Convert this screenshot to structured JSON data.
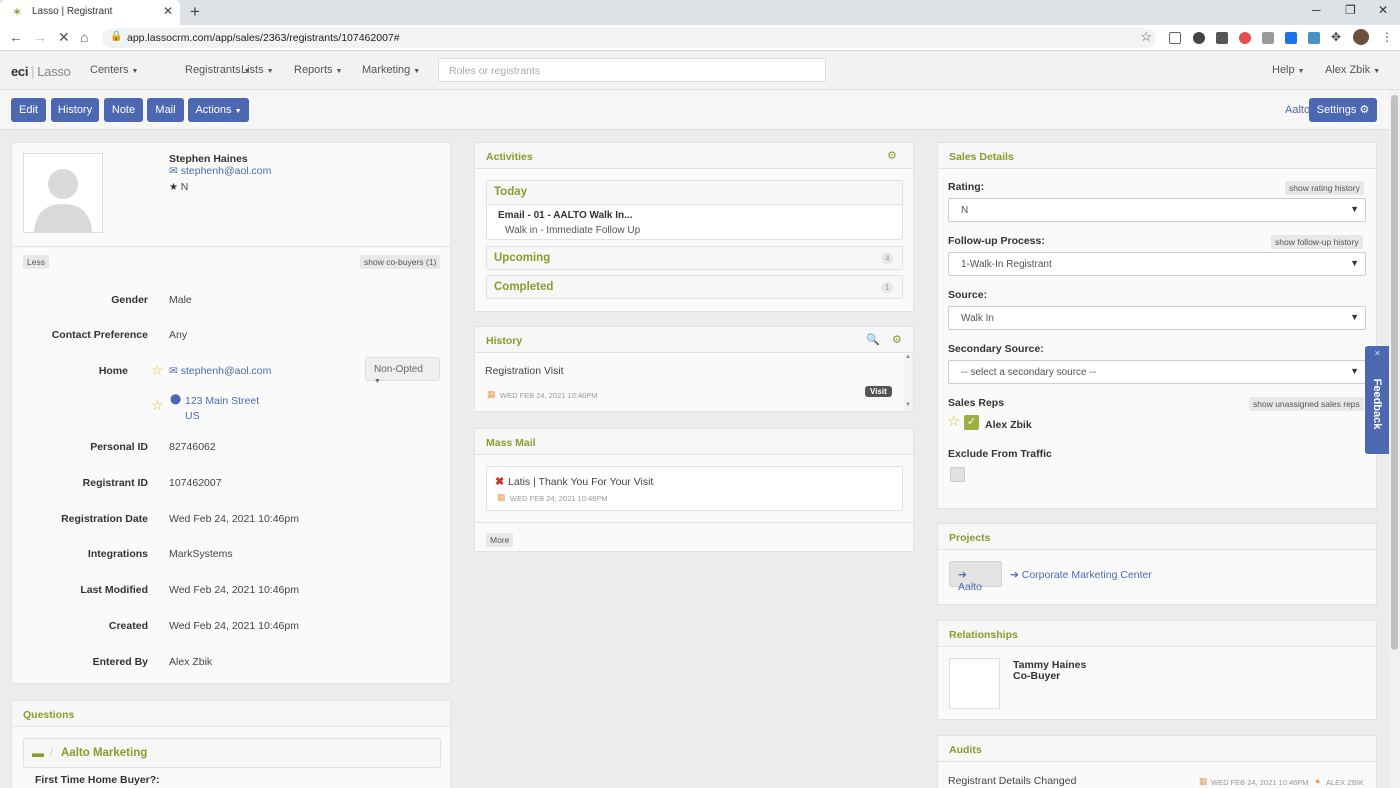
{
  "browser": {
    "tab_title": "Lasso | Registrant",
    "url": "app.lassocrm.com/app/sales/2363/registrants/107462007#"
  },
  "appnav": {
    "logo_main": "eci",
    "logo_sub": "Lasso",
    "menus": [
      "Centers",
      "Registrants",
      "Lists",
      "Reports",
      "Marketing"
    ],
    "search_placeholder": "Roles or registrants",
    "help": "Help",
    "user": "Alex Zbik"
  },
  "actionbar": {
    "buttons": [
      "Edit",
      "History",
      "Note",
      "Mail",
      "Actions"
    ],
    "project_link": "Aalto",
    "settings": "Settings"
  },
  "profile": {
    "name": "Stephen Haines",
    "email": "stephenh@aol.com",
    "rating": "N",
    "less": "Less",
    "show_cobuyers": "show co-buyers (1)",
    "fields": [
      {
        "label": "Gender",
        "value": "Male"
      },
      {
        "label": "Contact Preference",
        "value": "Any"
      },
      {
        "label": "Home",
        "value": "stephenh@aol.com"
      },
      {
        "label": "",
        "value": "123 Main Street"
      },
      {
        "label": "Personal ID",
        "value": "82746062"
      },
      {
        "label": "Registrant ID",
        "value": "107462007"
      },
      {
        "label": "Registration Date",
        "value": "Wed Feb 24, 2021 10:46pm"
      },
      {
        "label": "Integrations",
        "value": "MarkSystems"
      },
      {
        "label": "Last Modified",
        "value": "Wed Feb 24, 2021 10:46pm"
      },
      {
        "label": "Created",
        "value": "Wed Feb 24, 2021 10:46pm"
      },
      {
        "label": "Entered By",
        "value": "Alex Zbik"
      }
    ],
    "address_country": "US",
    "non_opted": "Non-Opted"
  },
  "questions": {
    "title": "Questions",
    "folder": "Aalto Marketing",
    "first_question": "First Time Home Buyer?:"
  },
  "activities": {
    "title": "Activities",
    "today": "Today",
    "today_item_title": "Email - 01 - AALTO Walk In...",
    "today_item_sub": "Walk in - Immediate Follow Up",
    "upcoming": "Upcoming",
    "upcoming_count": "4",
    "completed": "Completed",
    "completed_count": "1"
  },
  "history": {
    "title": "History",
    "item": "Registration Visit",
    "date": "WED FEB 24, 2021 10:46PM",
    "badge": "Visit"
  },
  "massmail": {
    "title": "Mass Mail",
    "item": "Latis | Thank You For Your Visit",
    "date": "WED FEB 24, 2021 10:46PM",
    "more": "More"
  },
  "sales": {
    "title": "Sales Details",
    "rating_label": "Rating:",
    "rating_history": "show rating history",
    "rating_value": "N",
    "followup_label": "Follow-up Process:",
    "followup_history": "show follow-up history",
    "followup_value": "1-Walk-In Registrant",
    "source_label": "Source:",
    "source_value": "Walk In",
    "secondary_label": "Secondary Source:",
    "secondary_value": "-- select a secondary source --",
    "reps_label": "Sales Reps",
    "reps_unassigned": "show unassigned sales reps",
    "rep_name": "Alex Zbik",
    "exclude_label": "Exclude From Traffic"
  },
  "projects": {
    "title": "Projects",
    "active": "Aalto",
    "other": "Corporate Marketing Center"
  },
  "relationships": {
    "title": "Relationships",
    "name": "Tammy Haines",
    "role": "Co-Buyer"
  },
  "audits": {
    "title": "Audits",
    "item": "Registrant Details Changed",
    "date": "WED FEB 24, 2021 10:46PM",
    "user": "ALEX ZBIK"
  },
  "feedback": "Feedback",
  "colors": {
    "accent": "#4c68b0",
    "olive": "#8c9a2b"
  }
}
